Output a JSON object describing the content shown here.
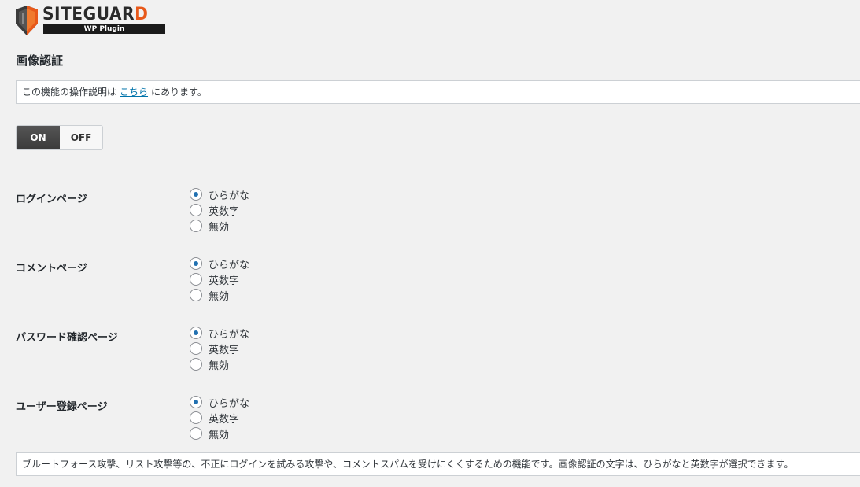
{
  "logo": {
    "brand_main": "SITEGUAR",
    "brand_last": "D",
    "sub": "WP Plugin"
  },
  "page_title": "画像認証",
  "notice": {
    "before": "この機能の操作説明は",
    "link": "こちら",
    "after": "にあります。"
  },
  "toggle": {
    "on_label": "ON",
    "off_label": "OFF",
    "state": "ON"
  },
  "sections": [
    {
      "label": "ログインページ",
      "options": [
        "ひらがな",
        "英数字",
        "無効"
      ],
      "selected": "ひらがな"
    },
    {
      "label": "コメントページ",
      "options": [
        "ひらがな",
        "英数字",
        "無効"
      ],
      "selected": "ひらがな"
    },
    {
      "label": "パスワード確認ページ",
      "options": [
        "ひらがな",
        "英数字",
        "無効"
      ],
      "selected": "ひらがな"
    },
    {
      "label": "ユーザー登録ページ",
      "options": [
        "ひらがな",
        "英数字",
        "無効"
      ],
      "selected": "ひらがな"
    }
  ],
  "description": "ブルートフォース攻撃、リスト攻撃等の、不正にログインを試みる攻撃や、コメントスパムを受けにくくするための機能です。画像認証の文字は、ひらがなと英数字が選択できます。",
  "colors": {
    "link": "#0073aa",
    "toggle_on": "#3a3a3a",
    "radio_checked": "#2271b1",
    "logo_accent": "#e8591a"
  }
}
